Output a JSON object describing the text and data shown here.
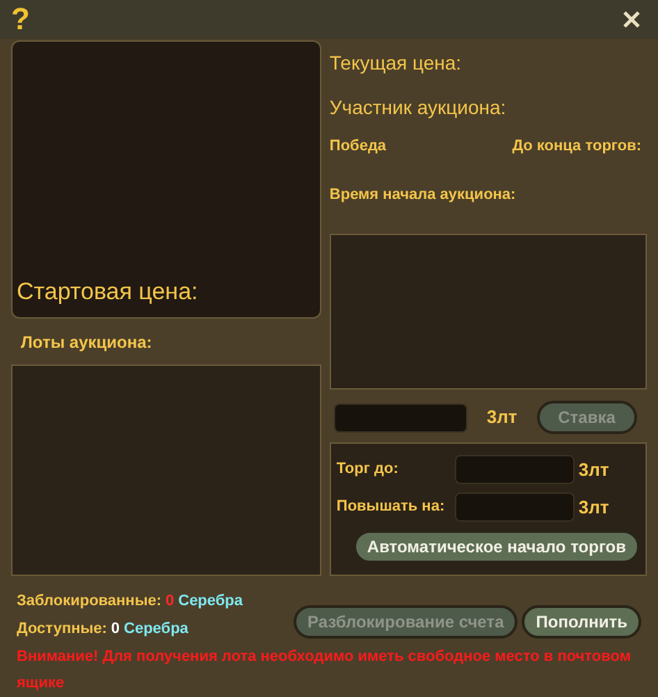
{
  "window": {
    "help": "?"
  },
  "lot_preview": {
    "start_price_label": "Стартовая цена:"
  },
  "lots": {
    "label": "Лоты аукциона:"
  },
  "info": {
    "current_price": "Текущая цена:",
    "participant": "Участник аукциона:",
    "win": "Победа",
    "time_left": "До конца торгов:",
    "start_time": "Время начала аукциона:"
  },
  "bid": {
    "unit": "3лт",
    "button": {
      "label": "Ставка",
      "disabled": true
    }
  },
  "auto_bid": {
    "fields": [
      {
        "label": "Торг до:",
        "unit": "3лт"
      },
      {
        "label": "Повышать на:",
        "unit": "3лт"
      }
    ],
    "button": {
      "label": "Автоматическое начало торгов",
      "disabled": false
    }
  },
  "balance": [
    {
      "label": "Заблокированные:",
      "amount": "0",
      "currency": "Серебра",
      "color": "#ff2a2a"
    },
    {
      "label": "Доступные:",
      "amount": "0",
      "currency": "Серебра",
      "color": "#ffffff"
    }
  ],
  "buttons": [
    {
      "label": "Разблокирование счета",
      "disabled": true
    },
    {
      "label": "Пополнить",
      "disabled": false
    }
  ],
  "warning": "Внимание! Для получения лота необходимо иметь свободное место в почтовом ящике"
}
